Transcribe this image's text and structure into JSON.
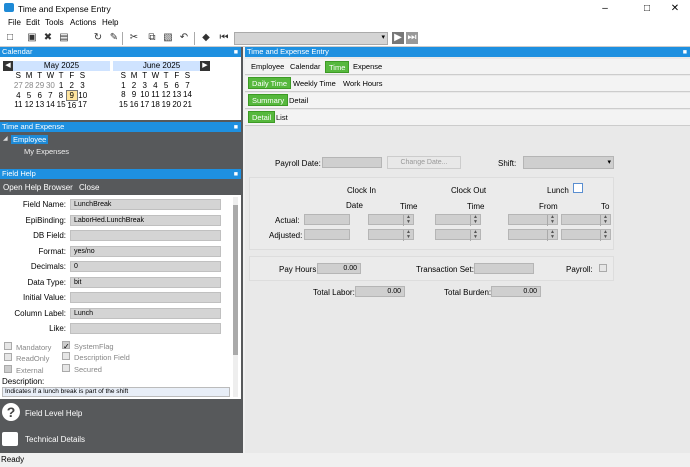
{
  "window": {
    "title": "Time and Expense Entry"
  },
  "menu": [
    "File",
    "Edit",
    "Tools",
    "Actions",
    "Help"
  ],
  "calendar_panel": {
    "title": "Calendar",
    "month1": {
      "name": "May 2025",
      "days": [
        "27",
        "28",
        "29",
        "30",
        "1",
        "2",
        "3",
        "4",
        "5",
        "6",
        "7",
        "8",
        "9",
        "10",
        "11",
        "12",
        "13",
        "14",
        "15",
        "16",
        "17"
      ]
    },
    "month2": {
      "name": "June 2025",
      "days": [
        "1",
        "2",
        "3",
        "4",
        "5",
        "6",
        "7",
        "8",
        "9",
        "10",
        "11",
        "12",
        "13",
        "14",
        "15",
        "16",
        "17",
        "18",
        "19",
        "20",
        "21"
      ]
    },
    "weekdays": [
      "S",
      "M",
      "T",
      "W",
      "T",
      "F",
      "S"
    ]
  },
  "te_panel": {
    "title": "Time and Expense",
    "employee": "Employee",
    "my_expenses": "My Expenses"
  },
  "field_help": {
    "title": "Field Help",
    "open_browser": "Open Help Browser",
    "close": "Close",
    "fields": [
      {
        "label": "Field Name:",
        "value": "LunchBreak"
      },
      {
        "label": "EpiBinding:",
        "value": "LaborHed.LunchBreak"
      },
      {
        "label": "DB Field:",
        "value": ""
      },
      {
        "label": "Format:",
        "value": "yes/no"
      },
      {
        "label": "Decimals:",
        "value": "0"
      },
      {
        "label": "Data Type:",
        "value": "bit"
      },
      {
        "label": "Initial Value:",
        "value": ""
      },
      {
        "label": "Column Label:",
        "value": "Lunch"
      },
      {
        "label": "Like:",
        "value": ""
      }
    ],
    "checks": {
      "mandatory": "Mandatory",
      "systemflag": "SystemFlag",
      "readonly": "ReadOnly",
      "descfield": "Description Field",
      "external": "External",
      "secured": "Secured"
    },
    "description_label": "Description:",
    "description": "Indicates if a lunch break is part of the shift",
    "field_level_help": "Field Level Help",
    "technical_details": "Technical Details"
  },
  "main": {
    "title": "Time and Expense Entry",
    "tabs1": [
      "Employee",
      "Calendar",
      "Time",
      "Expense"
    ],
    "tabs2": [
      "Daily Time",
      "Weekly Time",
      "Work Hours"
    ],
    "tabs3": [
      "Summary",
      "Detail"
    ],
    "tabs4": [
      "Detail",
      "List"
    ],
    "payroll_date": "Payroll Date:",
    "change_date": "Change Date...",
    "shift": "Shift:",
    "clock_in": "Clock In",
    "clock_out": "Clock Out",
    "lunch": "Lunch",
    "date": "Date",
    "time": "Time",
    "time2": "Time",
    "from": "From",
    "to": "To",
    "actual": "Actual:",
    "adjusted": "Adjusted:",
    "pay_hours": "Pay Hours:",
    "pay_hours_val": "0.00",
    "transaction_set": "Transaction Set:",
    "payroll": "Payroll:",
    "total_labor": "Total Labor:",
    "total_labor_val": "0.00",
    "total_burden": "Total Burden:",
    "total_burden_val": "0.00"
  },
  "status": "Ready"
}
